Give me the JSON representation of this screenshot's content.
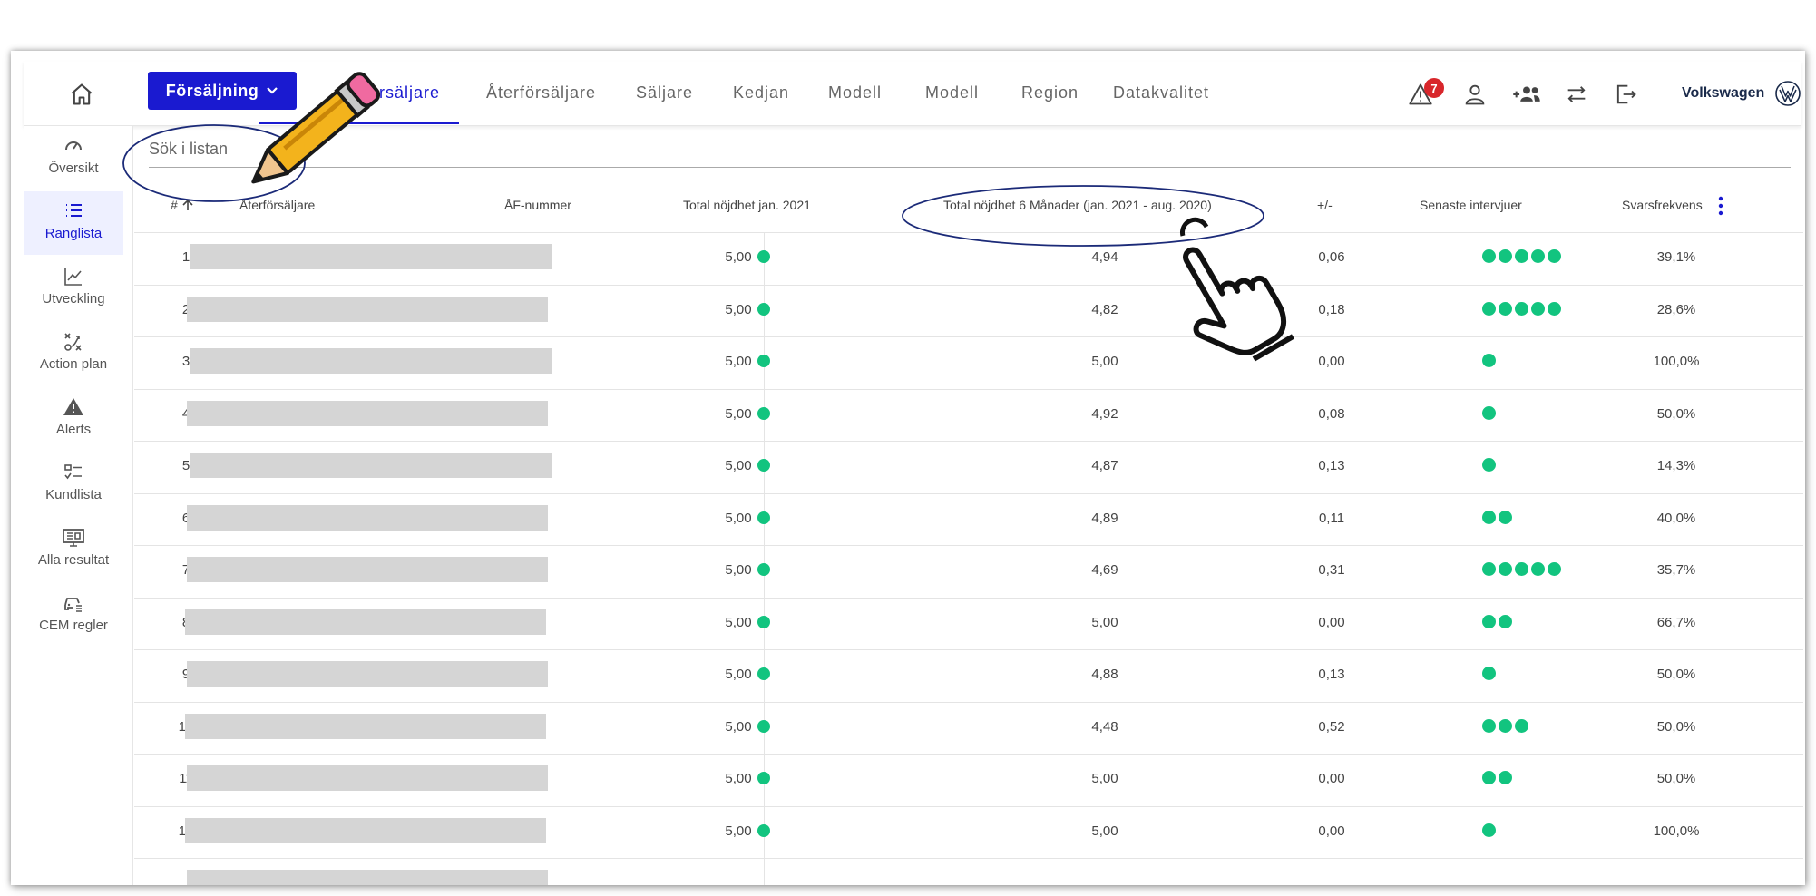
{
  "brand": {
    "name": "Volkswagen"
  },
  "colors": {
    "accent": "#1a1ad0",
    "green_dot": "#12c47f",
    "badge": "#d8262b",
    "annotation_ellipse": "#1b2a78"
  },
  "topbar": {
    "section_button": "Försäljning",
    "alert_count": "7",
    "tabs": [
      {
        "label": "Återförsäljare",
        "active": true,
        "partially_visible": "rsäljare"
      },
      {
        "label": "Återförsäljare",
        "active": false
      },
      {
        "label": "Säljare",
        "active": false
      },
      {
        "label": "Kedjan",
        "active": false
      },
      {
        "label": "Modell",
        "active": false
      },
      {
        "label": "Modell",
        "active": false
      },
      {
        "label": "Region",
        "active": false
      },
      {
        "label": "Datakvalitet",
        "active": false
      }
    ],
    "icons": [
      "home-icon",
      "alert-icon",
      "user-icon",
      "add-user-icon",
      "swap-icon",
      "logout-icon",
      "vw-logo-icon"
    ]
  },
  "sidebar": {
    "items": [
      {
        "label": "Översikt",
        "icon": "speedometer-icon",
        "active": false
      },
      {
        "label": "Ranglista",
        "icon": "ranked-list-icon",
        "active": true
      },
      {
        "label": "Utveckling",
        "icon": "line-chart-icon",
        "active": false
      },
      {
        "label": "Action plan",
        "icon": "action-plan-icon",
        "active": false
      },
      {
        "label": "Alerts",
        "icon": "warning-icon",
        "active": false
      },
      {
        "label": "Kundlista",
        "icon": "checklist-icon",
        "active": false
      },
      {
        "label": "Alla resultat",
        "icon": "monitor-icon",
        "active": false
      },
      {
        "label": "CEM regler",
        "icon": "car-rules-icon",
        "active": false
      }
    ]
  },
  "search": {
    "placeholder": "Sök i listan"
  },
  "table": {
    "headers": {
      "rank": "#",
      "dealer": "Återförsäljare",
      "dealer_number": "ÅF-nummer",
      "total": "Total nöjdhet jan. 2021",
      "six_months": "Total nöjdhet 6 Månader (jan. 2021 - aug. 2020)",
      "diff": "+/-",
      "interviews": "Senaste intervjuer",
      "response_rate": "Svarsfrekvens"
    },
    "rows": [
      {
        "rank": "1",
        "total": "5,00",
        "six": "4,94",
        "diff": "0,06",
        "interviews": 5,
        "rate": "39,1%"
      },
      {
        "rank": "2",
        "total": "5,00",
        "six": "4,82",
        "diff": "0,18",
        "interviews": 5,
        "rate": "28,6%"
      },
      {
        "rank": "3",
        "total": "5,00",
        "six": "5,00",
        "diff": "0,00",
        "interviews": 1,
        "rate": "100,0%"
      },
      {
        "rank": "4",
        "total": "5,00",
        "six": "4,92",
        "diff": "0,08",
        "interviews": 1,
        "rate": "50,0%"
      },
      {
        "rank": "5",
        "total": "5,00",
        "six": "4,87",
        "diff": "0,13",
        "interviews": 1,
        "rate": "14,3%"
      },
      {
        "rank": "6",
        "total": "5,00",
        "six": "4,89",
        "diff": "0,11",
        "interviews": 2,
        "rate": "40,0%"
      },
      {
        "rank": "7",
        "total": "5,00",
        "six": "4,69",
        "diff": "0,31",
        "interviews": 5,
        "rate": "35,7%"
      },
      {
        "rank": "8",
        "total": "5,00",
        "six": "5,00",
        "diff": "0,00",
        "interviews": 2,
        "rate": "66,7%"
      },
      {
        "rank": "9",
        "total": "5,00",
        "six": "4,88",
        "diff": "0,13",
        "interviews": 1,
        "rate": "50,0%"
      },
      {
        "rank": "10",
        "total": "5,00",
        "six": "4,48",
        "diff": "0,52",
        "interviews": 3,
        "rate": "50,0%"
      },
      {
        "rank": "11",
        "total": "5,00",
        "six": "5,00",
        "diff": "0,00",
        "interviews": 2,
        "rate": "50,0%"
      },
      {
        "rank": "12",
        "total": "5,00",
        "six": "5,00",
        "diff": "0,00",
        "interviews": 1,
        "rate": "100,0%"
      }
    ]
  }
}
